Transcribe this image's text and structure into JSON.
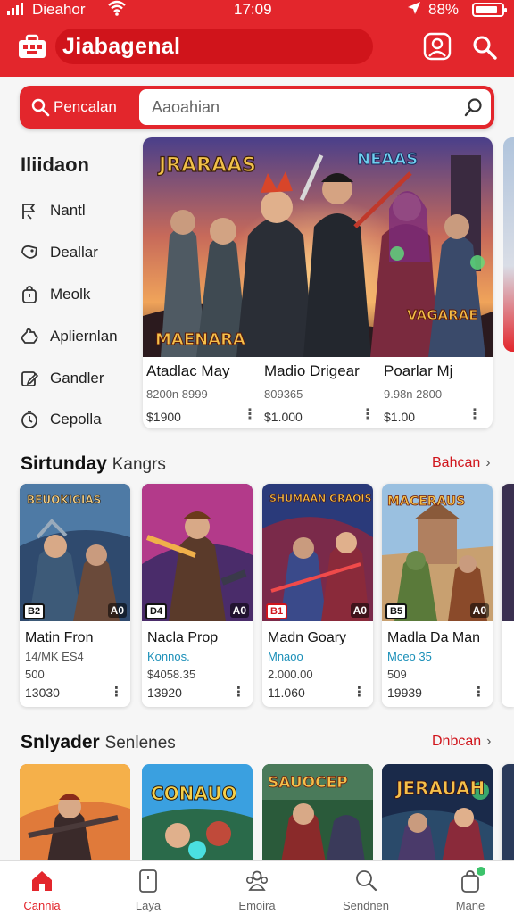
{
  "status": {
    "carrier": "Dieahor",
    "time": "17:09",
    "battery": "88%"
  },
  "header": {
    "title": "Jiabagenal"
  },
  "search": {
    "label": "Pencalan",
    "placeholder": "Aaoahian"
  },
  "sidebar": {
    "title": "Iliidaon",
    "items": [
      {
        "label": "Nantl",
        "icon": "flag-icon"
      },
      {
        "label": "Deallar",
        "icon": "tag-icon"
      },
      {
        "label": "Meolk",
        "icon": "bag-icon"
      },
      {
        "label": "Apliernlan",
        "icon": "puzzle-icon"
      },
      {
        "label": "Gandler",
        "icon": "edit-icon"
      },
      {
        "label": "Cepolla",
        "icon": "clock-icon"
      }
    ]
  },
  "featured": {
    "banner_left": "JRARAAS",
    "banner_right": "NEAAS",
    "banner_bottom_left": "MAENARA",
    "banner_bottom_right": "VAGARAE",
    "items": [
      {
        "name": "Atadlac May",
        "sub": "8200n 8999",
        "price": "$1900"
      },
      {
        "name": "Madio Drigear",
        "sub": "809365",
        "price": "$1.000"
      },
      {
        "name": "Poarlar Mj",
        "sub": "9.98n 2800",
        "price": "$1.00"
      }
    ]
  },
  "section1": {
    "title": "Sirtunday",
    "title_light": "Kangrs",
    "link": "Bahcan",
    "cards": [
      {
        "art_title": "BEUOKIGIAS",
        "tag_left": "B2",
        "tag_right": "A0",
        "name": "Matin Fron",
        "sub": "14/MK ES4",
        "extra": "500",
        "price": "13030"
      },
      {
        "art_title": "",
        "tag_left": "D4",
        "tag_right": "A0",
        "name": "Nacla Prop",
        "sub": "Konnos.",
        "extra": "$4058.35",
        "price": "13920"
      },
      {
        "art_title": "SHUMAAN GRAOIS",
        "tag_left": "B1",
        "tag_right": "A0",
        "name": "Madn Goary",
        "sub": "Mnaoo",
        "extra": "2.000.00",
        "price": "11.060"
      },
      {
        "art_title": "MACERAUS",
        "tag_left": "B5",
        "tag_right": "A0",
        "name": "Madla Da Man",
        "sub": "Mceo 35",
        "extra": "509",
        "price": "19939"
      }
    ]
  },
  "section2": {
    "title": "Snlyader",
    "title_light": "Senlenes",
    "link": "Dnbcan",
    "cards": [
      {
        "art_title": ""
      },
      {
        "art_title": "CONAUO"
      },
      {
        "art_title": "SAUOCEP"
      },
      {
        "art_title": "JERAUAH"
      }
    ]
  },
  "bottom_nav": [
    {
      "label": "Cannia",
      "icon": "home-icon",
      "active": true
    },
    {
      "label": "Laya",
      "icon": "phone-icon",
      "active": false
    },
    {
      "label": "Emoira",
      "icon": "people-icon",
      "active": false
    },
    {
      "label": "Sendnen",
      "icon": "search-icon",
      "active": false
    },
    {
      "label": "Mane",
      "icon": "bag-icon",
      "active": false
    }
  ],
  "colors": {
    "brand": "#e3262c",
    "link": "#d0141b",
    "accent_blue": "#1a8fb8"
  }
}
